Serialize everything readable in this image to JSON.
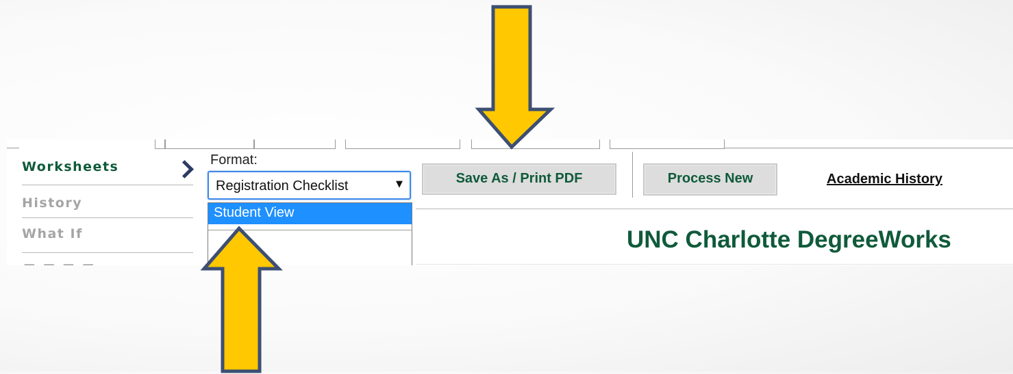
{
  "nav": {
    "items": [
      {
        "label": "Worksheets"
      },
      {
        "label": "History"
      },
      {
        "label": "What If"
      }
    ]
  },
  "format": {
    "label": "Format:",
    "selected": "Registration Checklist",
    "caret": "▼",
    "options": [
      {
        "label": "Student View",
        "highlighted": true
      }
    ]
  },
  "toolbar": {
    "save_pdf_label": "Save As / Print PDF",
    "process_new_label": "Process New",
    "academic_history_label": "Academic History"
  },
  "site": {
    "title": "UNC Charlotte DegreeWorks"
  },
  "colors": {
    "brand_green": "#0f5a3a",
    "arrow_fill": "#ffc800",
    "arrow_outline": "#3d4f72",
    "highlight_blue": "#1e90ff",
    "chevron_navy": "#2c3b64"
  },
  "icons": {
    "nav_chevron": "chevron-right-icon",
    "callout_arrow_down": "arrow-down-icon",
    "callout_arrow_up": "arrow-up-icon"
  }
}
